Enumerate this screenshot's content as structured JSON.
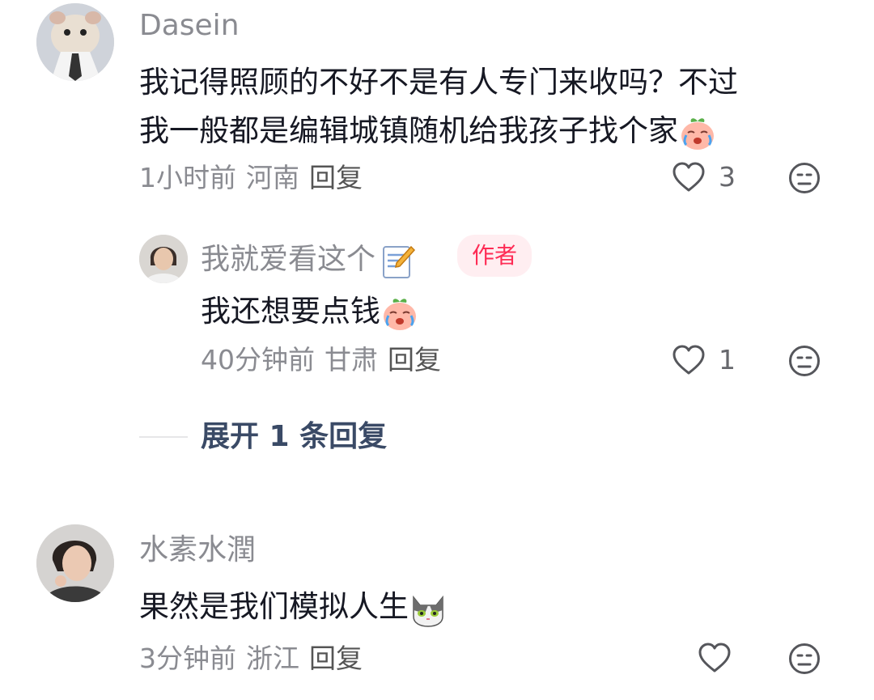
{
  "comments": [
    {
      "username": "Dasein",
      "text_line1": "我记得照顾的不好不是有人专门来收吗？不过",
      "text_line2": "我一般都是编辑城镇随机给我孩子找个家",
      "emoji": "crying-peach-emoji",
      "time": "1小时前",
      "location": "河南",
      "reply_label": "回复",
      "likes": "3"
    },
    {
      "username": "水素水潤",
      "text": "果然是我们模拟人生",
      "emoji": "cat-emoji",
      "time": "3分钟前",
      "location": "浙江",
      "reply_label": "回复"
    }
  ],
  "reply": {
    "username": "我就爱看这个",
    "username_emoji": "memo-icon",
    "badge": "作者",
    "text": "我还想要点钱",
    "emoji": "crying-peach-emoji",
    "time": "40分钟前",
    "location": "甘肃",
    "reply_label": "回复",
    "likes": "1"
  },
  "expand_label": "展开 1 条回复",
  "colors": {
    "accent_badge": "#fe2c55",
    "badge_bg": "#ffeef1",
    "expand_text": "#3a4a66",
    "muted": "#8a8b91"
  }
}
